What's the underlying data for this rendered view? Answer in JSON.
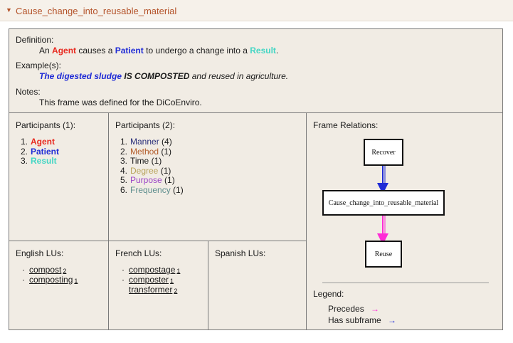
{
  "header": {
    "title": "Cause_change_into_reusable_material"
  },
  "definition": {
    "label": "Definition:",
    "prefix": "An",
    "agent": "Agent",
    "mid1": "causes a",
    "patient": "Patient",
    "mid2": "to undergo a change into a",
    "result": "Result",
    "suffix": "."
  },
  "examples": {
    "label": "Example(s):",
    "subject": "The digested sludge",
    "verb": "IS COMPOSTED",
    "rest": "and reused in agriculture."
  },
  "notes": {
    "label": "Notes:",
    "text": "This frame was defined for the DiCoEnviro."
  },
  "participants1": {
    "heading": "Participants (1):",
    "items": [
      {
        "num": "1.",
        "name": "Agent",
        "color": "#e8291f"
      },
      {
        "num": "2.",
        "name": "Patient",
        "color": "#1f2bd6"
      },
      {
        "num": "3.",
        "name": "Result",
        "color": "#44d6c4"
      }
    ]
  },
  "participants2": {
    "heading": "Participants (2):",
    "items": [
      {
        "num": "1.",
        "name": "Manner",
        "count": "(4)"
      },
      {
        "num": "2.",
        "name": "Method",
        "count": "(1)"
      },
      {
        "num": "3.",
        "name": "Time",
        "count": "(1)"
      },
      {
        "num": "4.",
        "name": "Degree",
        "count": "(1)"
      },
      {
        "num": "5.",
        "name": "Purpose",
        "count": "(1)"
      },
      {
        "num": "6.",
        "name": "Frequency",
        "count": "(1)"
      }
    ]
  },
  "english_lus": {
    "heading": "English LUs:",
    "items": [
      {
        "word": "compost",
        "sub": "2"
      },
      {
        "word": "composting",
        "sub": "1"
      }
    ]
  },
  "french_lus": {
    "heading": "French LUs:",
    "items": [
      {
        "word": "compostage",
        "sub": "1"
      },
      {
        "word": "composter",
        "sub": "1"
      },
      {
        "word": "transformer",
        "sub": "2"
      }
    ]
  },
  "spanish_lus": {
    "heading": "Spanish LUs:"
  },
  "relations": {
    "heading": "Frame Relations:",
    "nodes": {
      "top": "Recover",
      "middle": "Cause_change_into_reusable_material",
      "bottom": "Reuse"
    },
    "legend": {
      "label": "Legend:",
      "precedes": "Precedes",
      "precedes_arrow": "→",
      "subframe": "Has subframe",
      "subframe_arrow": "→"
    },
    "colors": {
      "precedes": "#ff2bd6",
      "subframe": "#1f2bd6"
    }
  },
  "icons": {
    "collapse": "caret-down-icon",
    "bullet": "bullet-icon"
  }
}
